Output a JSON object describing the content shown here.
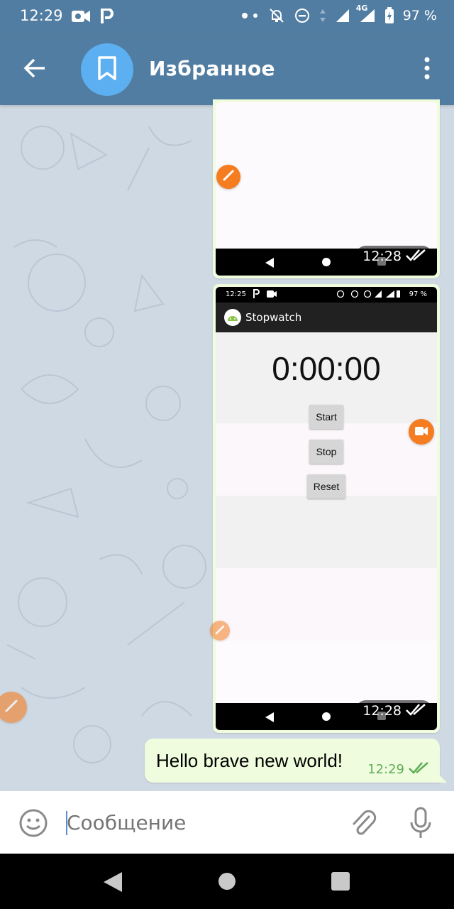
{
  "status_bar": {
    "time": "12:29",
    "network": "4G",
    "battery": "97 %"
  },
  "header": {
    "title": "Избранное"
  },
  "messages": {
    "card1": {
      "time": "12:28"
    },
    "card2": {
      "time": "12:28",
      "inner_status_time": "12:25",
      "inner_battery": "97 %",
      "app_title": "Stopwatch",
      "stopwatch_value": "0:00:00",
      "buttons": {
        "start": "Start",
        "stop": "Stop",
        "reset": "Reset"
      }
    },
    "text": {
      "body": "Hello brave new world!",
      "time": "12:29"
    }
  },
  "input": {
    "placeholder": "Сообщение"
  },
  "colors": {
    "header": "#517da2",
    "bubble": "#effdde",
    "check": "#5fad56",
    "accent_orange": "#f57c1f"
  }
}
